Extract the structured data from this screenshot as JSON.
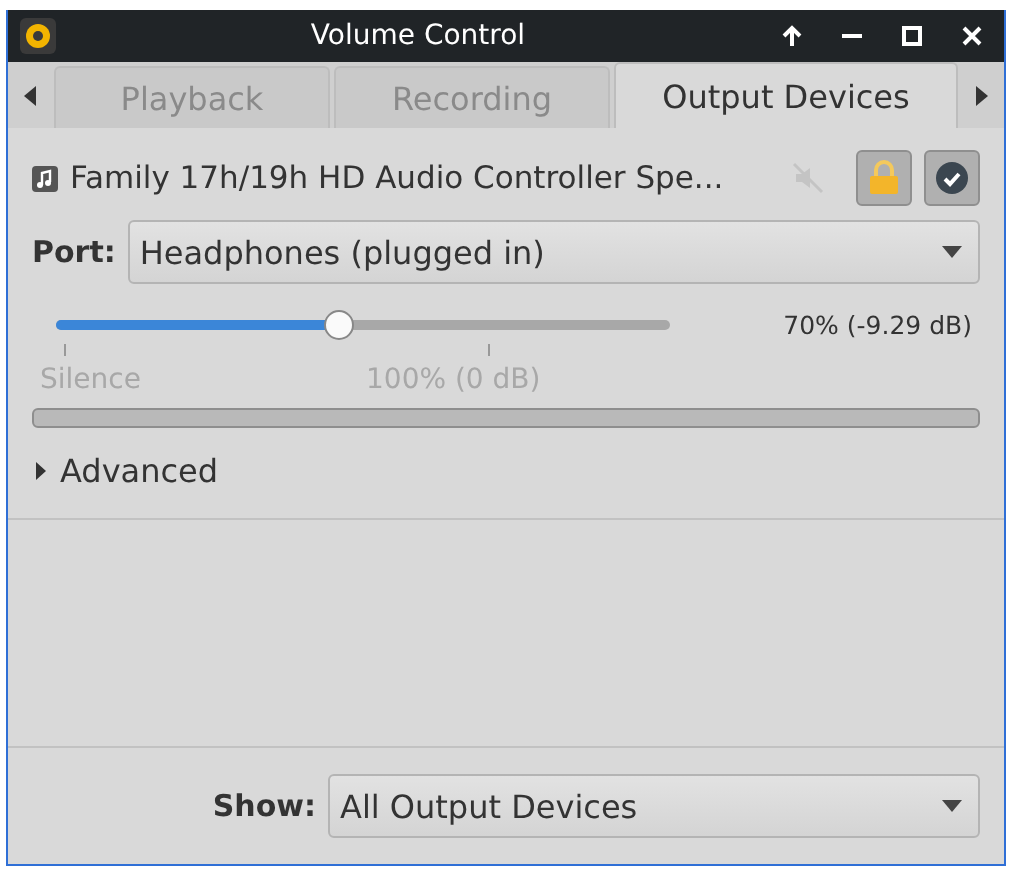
{
  "window": {
    "title": "Volume Control"
  },
  "tabs": [
    {
      "label": "Playback",
      "selected": false
    },
    {
      "label": "Recording",
      "selected": false
    },
    {
      "label": "Output Devices",
      "selected": true
    }
  ],
  "device": {
    "name": "Family 17h/19h HD Audio Controller Spe...",
    "mute_on": false,
    "lock_on": true,
    "default_on": true,
    "port_label": "Port:",
    "port_value": "Headphones (plugged in)",
    "volume": {
      "level": 0.46,
      "reading": "70% (-9.29 dB)",
      "marks": [
        "Silence",
        "100% (0 dB)"
      ]
    },
    "advanced": {
      "label": "Advanced",
      "expanded": false
    }
  },
  "show": {
    "label": "Show:",
    "value": "All Output Devices"
  }
}
